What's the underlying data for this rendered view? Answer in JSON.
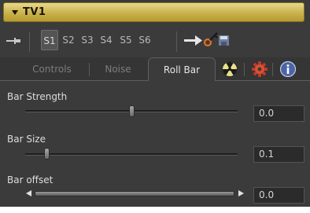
{
  "window": {
    "title": "TV1",
    "colors": {
      "title_bar": "#c9b14e",
      "panel_bg": "#3b3b3b",
      "icon_orange": "#e07020"
    }
  },
  "toolbar": {
    "slots": [
      "S1",
      "S2",
      "S3",
      "S4",
      "S5",
      "S6"
    ],
    "selected_slot": "S1",
    "icons": [
      "pin-icon",
      "arrow-right-icon",
      "key-icon",
      "save-icon"
    ]
  },
  "tabs": {
    "items": [
      "Controls",
      "Noise",
      "Roll Bar"
    ],
    "active": "Roll Bar",
    "icons": [
      "radioactive-icon",
      "gear-icon",
      "info-icon"
    ]
  },
  "controls": {
    "bar_strength": {
      "label": "Bar Strength",
      "value": "0.0",
      "fraction": 0.5
    },
    "bar_size": {
      "label": "Bar Size",
      "value": "0.1",
      "fraction": 0.1
    },
    "bar_offset": {
      "label": "Bar offset",
      "value": "0.0"
    }
  }
}
